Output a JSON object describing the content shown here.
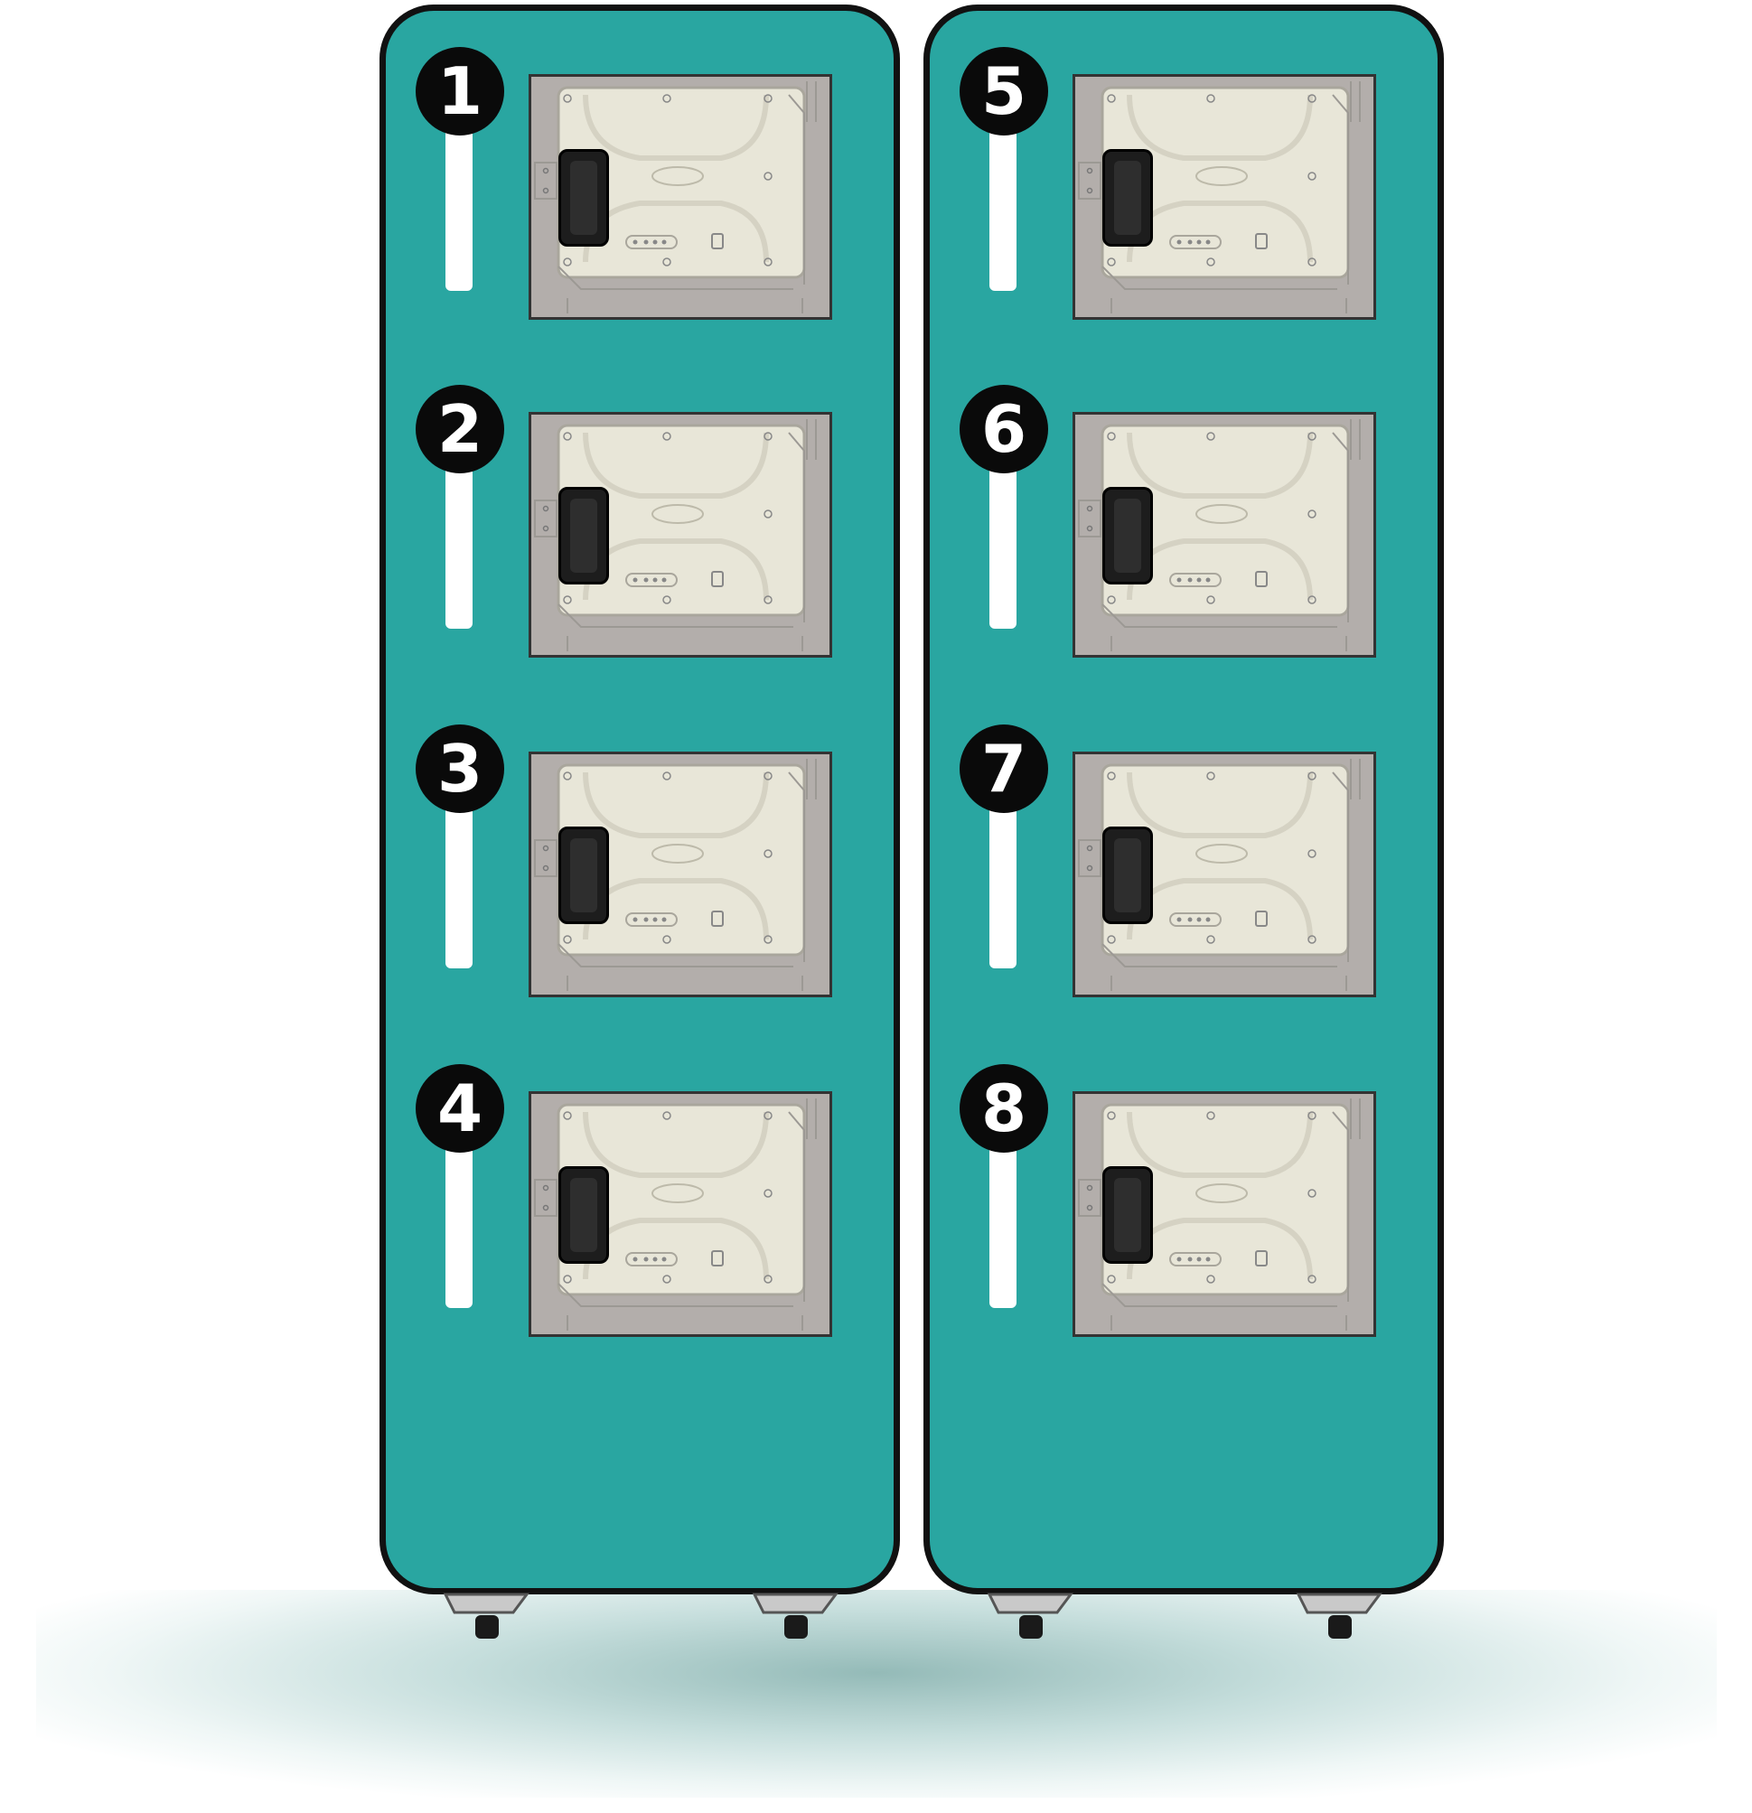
{
  "lockers": [
    {
      "number": "1"
    },
    {
      "number": "2"
    },
    {
      "number": "3"
    },
    {
      "number": "4"
    },
    {
      "number": "5"
    },
    {
      "number": "6"
    },
    {
      "number": "7"
    },
    {
      "number": "8"
    }
  ],
  "colors": {
    "cabinet": "#29a6a1",
    "outline": "#111111",
    "badge": "#0a0a0a",
    "door_frame": "#b3aeab",
    "door_panel": "#e8e6d8",
    "handle": "#1d1d1d",
    "shadow": "#3c827d"
  }
}
